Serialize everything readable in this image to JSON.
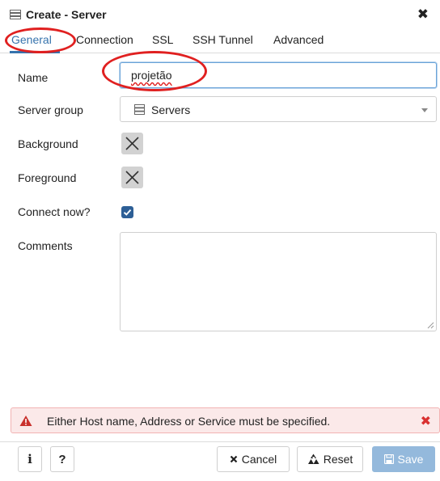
{
  "dialog": {
    "title": "Create - Server",
    "title_icon": "server-icon",
    "close_glyph": "✖"
  },
  "tabs": [
    {
      "label": "General",
      "active": true
    },
    {
      "label": "Connection",
      "active": false
    },
    {
      "label": "SSL",
      "active": false
    },
    {
      "label": "SSH Tunnel",
      "active": false
    },
    {
      "label": "Advanced",
      "active": false
    }
  ],
  "form": {
    "name": {
      "label": "Name",
      "value": "projetão"
    },
    "server_group": {
      "label": "Server group",
      "value": "Servers",
      "icon": "server-group-icon"
    },
    "background": {
      "label": "Background",
      "icon": "color-picker-empty-icon"
    },
    "foreground": {
      "label": "Foreground",
      "icon": "color-picker-empty-icon"
    },
    "connect_now": {
      "label": "Connect now?",
      "checked": true
    },
    "comments": {
      "label": "Comments",
      "value": ""
    }
  },
  "alert": {
    "message": "Either Host name, Address or Service must be specified.",
    "icon": "warning-icon",
    "dismiss_glyph": "✖"
  },
  "footer": {
    "info_label": "i",
    "help_label": "?",
    "cancel_label": "Cancel",
    "reset_label": "Reset",
    "save_label": "Save"
  },
  "colors": {
    "accent": "#3673ad",
    "annotation": "#e02020",
    "checkbox": "#2d5f96",
    "alert_bg": "#fbe9e9",
    "save_disabled": "#94b9dc"
  }
}
